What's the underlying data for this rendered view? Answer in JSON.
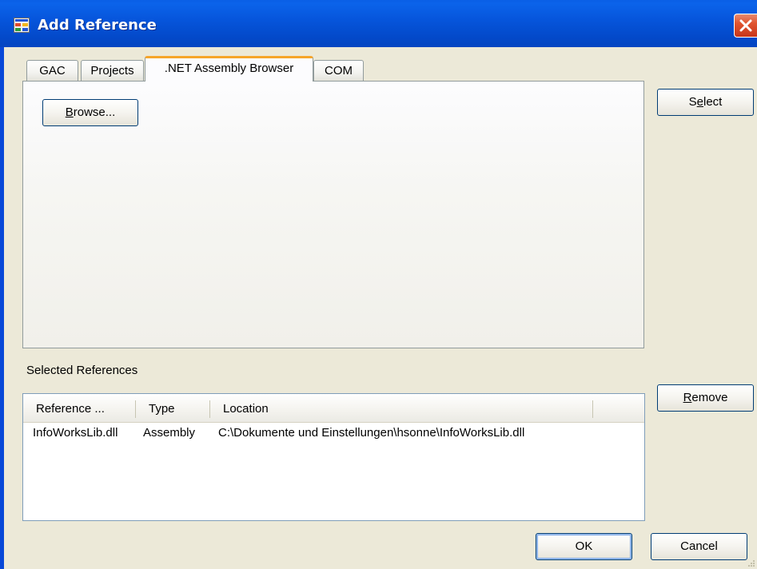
{
  "window": {
    "title": "Add Reference"
  },
  "tabs": [
    {
      "label": "GAC",
      "active": false
    },
    {
      "label": "Projects",
      "active": false
    },
    {
      "label": ".NET Assembly Browser",
      "active": true
    },
    {
      "label": "COM",
      "active": false
    }
  ],
  "panel": {
    "browse_prefix": "",
    "browse_mnemonic": "B",
    "browse_rest": "rowse..."
  },
  "buttons": {
    "select_pre": "S",
    "select_mnemonic": "e",
    "select_post": "lect",
    "remove_mnemonic": "R",
    "remove_post": "emove",
    "ok": "OK",
    "cancel": "Cancel"
  },
  "selected_references": {
    "label": "Selected References",
    "columns": [
      "Reference ...",
      "Type",
      "Location"
    ],
    "rows": [
      {
        "reference": "InfoWorksLib.dll",
        "type": "Assembly",
        "location": "C:\\Dokumente und Einstellungen\\hsonne\\InfoWorksLib.dll"
      }
    ]
  },
  "colors": {
    "titlebar": "#0654da",
    "active_tab_accent": "#f6a52b",
    "close_button": "#e0542f",
    "dialog_background": "#ece9d8"
  }
}
